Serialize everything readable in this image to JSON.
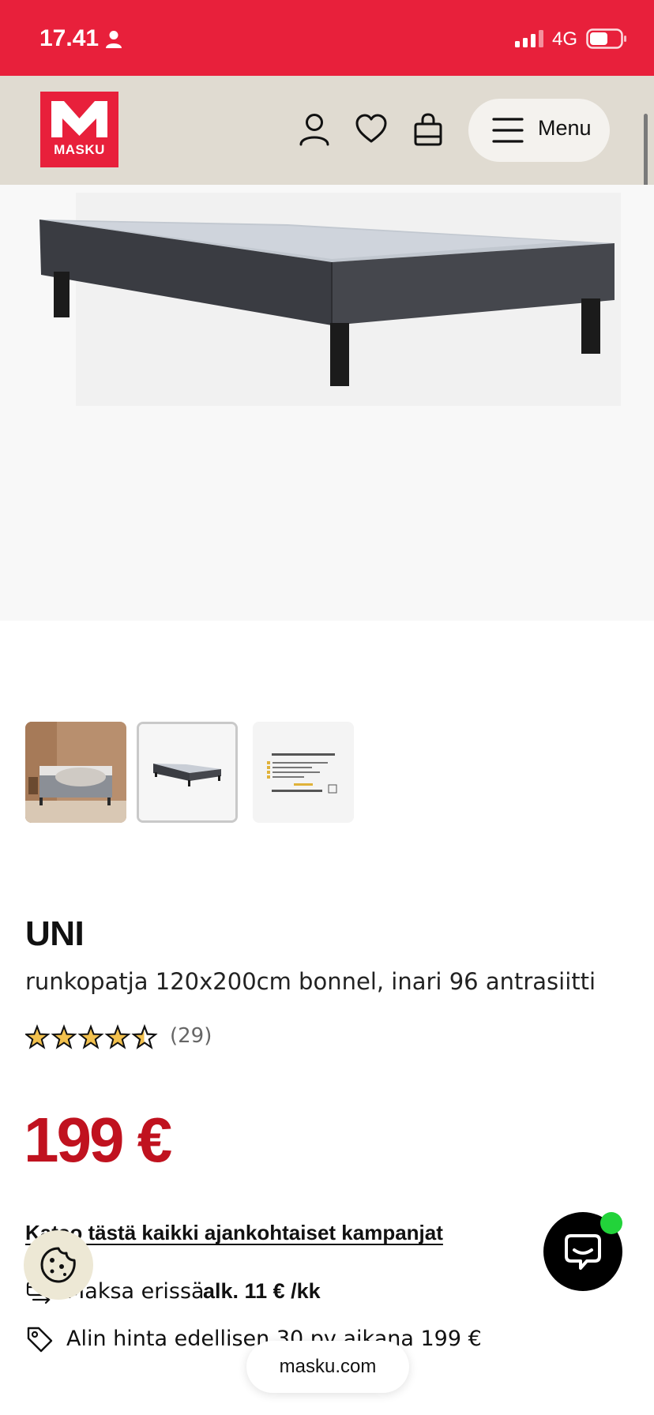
{
  "status_bar": {
    "time": "17.41",
    "network": "4G"
  },
  "header": {
    "logo_text": "MASKU",
    "menu_label": "Menu"
  },
  "product": {
    "brand": "UNI",
    "subtitle": "runkopatja 120x200cm bonnel, inari 96 antrasiitti",
    "rating": 4.5,
    "rating_max": 5,
    "reviews": "(29)",
    "price": "199 €"
  },
  "promo": {
    "campaign_link": "Katso tästä kaikki ajankohtaiset kampanjat",
    "installment_label": "Maksa erissä",
    "installment_value": "alk. 11 € /kk",
    "lowest_price": "Alin hinta edellisen 30 pv aikana 199 €"
  },
  "browser": {
    "url": "masku.com"
  },
  "colors": {
    "brand_red": "#e8203b",
    "price_red": "#c0121f",
    "header_beige": "#e0dbd1",
    "star": "#f2c14e"
  },
  "icons": [
    "person-icon",
    "heart-icon",
    "bag-icon",
    "hamburger-icon",
    "star-icon",
    "installment-icon",
    "price-tag-icon",
    "cookie-icon",
    "chat-icon"
  ]
}
